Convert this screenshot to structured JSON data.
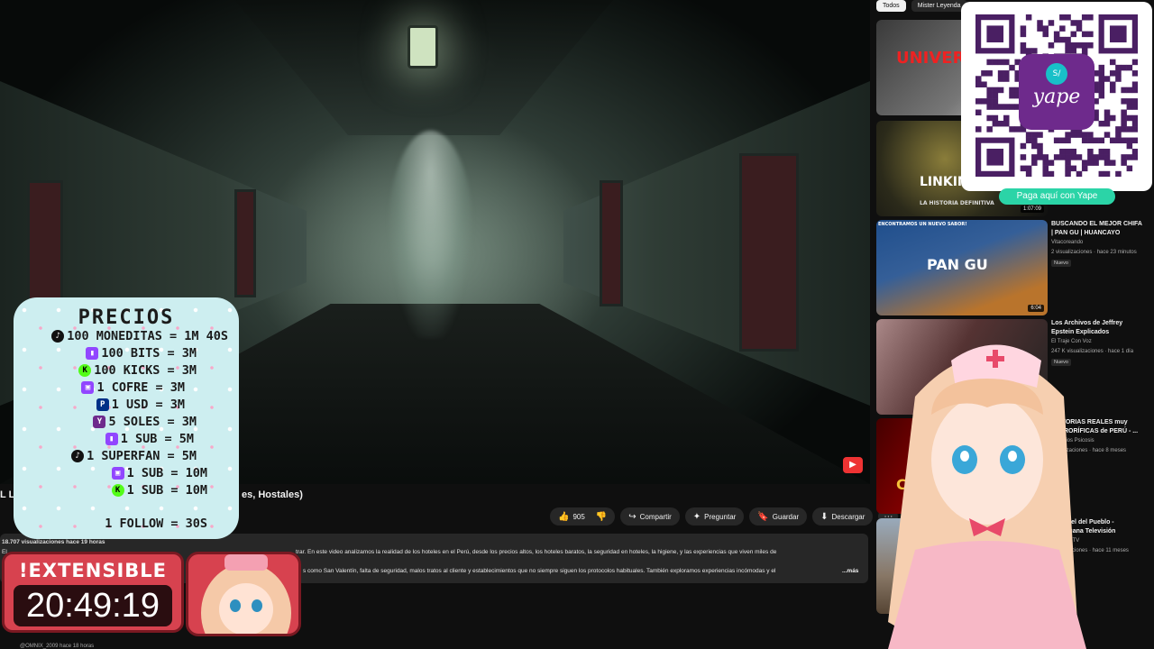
{
  "video": {
    "title_start": "L L",
    "title_end": "es, Hostales)",
    "views_line": "18.707 visualizaciones  hace 19 horas",
    "desc_line1_a": "El",
    "desc_line1_b": "trar. En este video analizamos la realidad de los hoteles en el Perú, desde los precios altos, los hoteles baratos, la seguridad en hoteles, la higiene, y las experiencias que viven miles de",
    "desc_line2": "s como San Valentín, falta de seguridad, malos tratos al cliente y establecimientos que no siempre siguen los protocolos habituales. También exploramos experiencias incómodas y el",
    "more": "...más",
    "comment_author": "@OMNIX_2009  hace 18 horas"
  },
  "actions": {
    "likes": "905",
    "share": "Compartir",
    "ask": "Preguntar",
    "save": "Guardar",
    "download": "Descargar"
  },
  "chips": [
    "Todos",
    "Mister Leyenda"
  ],
  "recommendations": [
    {
      "thumb_text": "UNIVER",
      "title": "",
      "channel": "",
      "meta": "",
      "duration": "",
      "badge": ""
    },
    {
      "thumb_text": "LINKIN",
      "thumb_sub": "LA HISTORIA DEFINITIVA",
      "title": "",
      "channel": "",
      "meta": "",
      "duration": "1:07:09",
      "badge": ""
    },
    {
      "thumb_banner": "ENCONTRAMOS UN NUEVO SABOR!",
      "thumb_text": "PAN GU",
      "title": "BUSCANDO EL MEJOR CHIFA | PAN GU | HUANCAYO",
      "channel": "Vitacoreando",
      "meta": "2 visualizaciones · hace 23 minutos",
      "duration": "6:04",
      "badge": "Nuevo"
    },
    {
      "title": "Los Archivos de Jeffrey Epstein Explicados",
      "channel": "El Traje Con Voz",
      "meta": "247 K visualizaciones · hace 1 día",
      "duration": "",
      "badge": "Nuevo"
    },
    {
      "thumb_text": "CAS",
      "title": "HISTORIAS REALES muy TERRORÍFICAS de PERÚ - ...",
      "channel": "Misterios Psicosis",
      "meta": "visualizaciones · hace 8 meses",
      "duration": "",
      "badge": ""
    },
    {
      "title": "El Ángel del Pueblo - Americana Televisión",
      "channel": "América TV",
      "meta": "visualizaciones · hace 11 meses",
      "duration": "",
      "badge": ""
    }
  ],
  "qr": {
    "brand": "yape",
    "cta": "Paga aquí con Yape"
  },
  "prices": {
    "title": "PRECIOS",
    "rows": [
      {
        "icon": "tiktok-icon",
        "text": "100 MONEDITAS = 1M 40S"
      },
      {
        "icon": "twitch-icon",
        "text": "100 BITS = 3M"
      },
      {
        "icon": "kick-icon",
        "text": "100 KICKS = 3M"
      },
      {
        "icon": "twitch-chest-icon",
        "text": "1 COFRE = 3M"
      },
      {
        "icon": "paypal-icon",
        "text": "1 USD = 3M"
      },
      {
        "icon": "yape-icon",
        "text": "5 SOLES = 3M"
      },
      {
        "icon": "twitch-icon",
        "text": "1 SUB = 5M"
      },
      {
        "icon": "tiktok-icon",
        "text": "1 SUPERFAN = 5M"
      },
      {
        "icon": "twitch-chest-icon",
        "text": "1 SUB = 10M"
      },
      {
        "icon": "kick-icon",
        "text": "1 SUB = 10M"
      },
      {
        "icon": "",
        "text": "1 FOLLOW = 30S"
      }
    ]
  },
  "timer": {
    "label": "!EXTENSIBLE",
    "value": "20:49:19"
  },
  "colors": {
    "accent_red": "#d7424f",
    "yape_purple": "#6e2a8c",
    "yape_green": "#2bd4a7",
    "panel_cyan": "#cdeef0"
  }
}
